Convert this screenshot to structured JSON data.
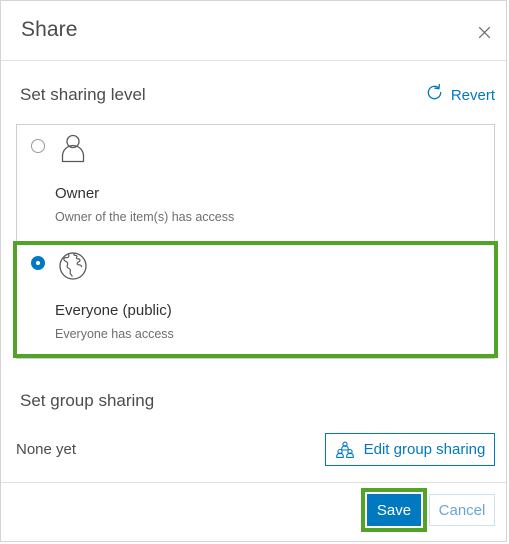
{
  "dialog": {
    "title": "Share",
    "close_icon": "close-icon"
  },
  "sharing_level": {
    "heading": "Set sharing level",
    "revert": {
      "label": "Revert",
      "icon": "revert-icon"
    },
    "options": [
      {
        "id": "owner",
        "label": "Owner",
        "description": "Owner of the item(s) has access",
        "icon": "person-icon",
        "selected": false
      },
      {
        "id": "everyone",
        "label": "Everyone (public)",
        "description": "Everyone has access",
        "icon": "globe-icon",
        "selected": true
      }
    ]
  },
  "group_sharing": {
    "heading": "Set group sharing",
    "status": "None yet",
    "edit_button": {
      "label": "Edit group sharing",
      "icon": "group-people-icon"
    }
  },
  "footer": {
    "save_label": "Save",
    "cancel_label": "Cancel"
  },
  "colors": {
    "accent_blue": "#0079c1",
    "annotation_green": "#52a328",
    "text_dark": "#323232",
    "text_muted": "#6e6e6e",
    "border_light": "#cfcfcf"
  }
}
